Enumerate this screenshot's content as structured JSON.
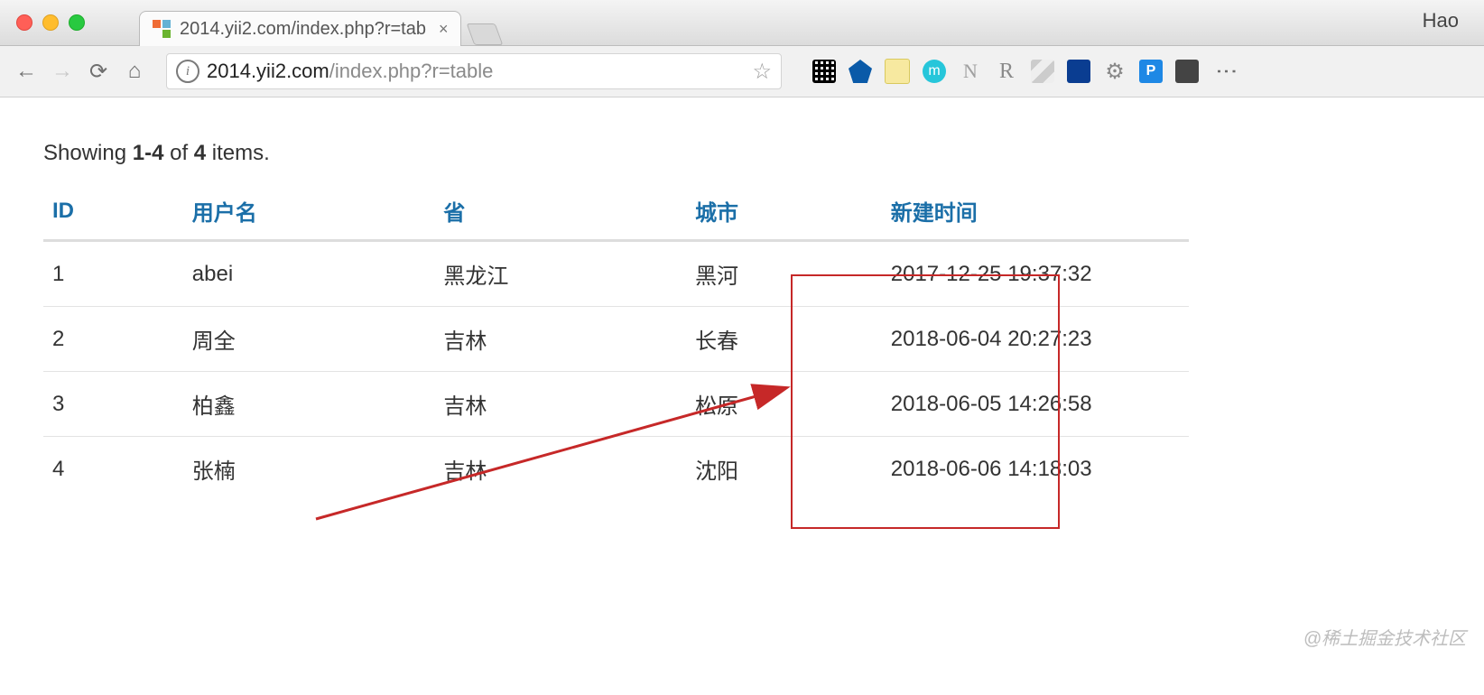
{
  "chrome": {
    "profile_name": "Hao",
    "tab_title": "2014.yii2.com/index.php?r=tab",
    "url_host": "2014.yii2.com",
    "url_path": "/index.php?r=table"
  },
  "extensions": {
    "qr": "qr-code",
    "vimium": "V",
    "note": "",
    "m": "m",
    "n": "N",
    "r": "R",
    "stripes": "",
    "zhihu": "",
    "gear": "⚙",
    "p": "P",
    "avatar": ""
  },
  "summary": {
    "prefix": "Showing ",
    "range": "1-4",
    "mid": " of ",
    "total": "4",
    "suffix": " items."
  },
  "columns": {
    "id": "ID",
    "username": "用户名",
    "province": "省",
    "city": "城市",
    "created": "新建时间"
  },
  "rows": [
    {
      "id": "1",
      "username": "abei",
      "province": "黑龙江",
      "city": "黑河",
      "created": "2017-12-25 19:37:32"
    },
    {
      "id": "2",
      "username": "周全",
      "province": "吉林",
      "city": "长春",
      "created": "2018-06-04 20:27:23"
    },
    {
      "id": "3",
      "username": "柏鑫",
      "province": "吉林",
      "city": "松原",
      "created": "2018-06-05 14:26:58"
    },
    {
      "id": "4",
      "username": "张楠",
      "province": "吉林",
      "city": "沈阳",
      "created": "2018-06-06 14:18:03"
    }
  ],
  "watermark": "@稀土掘金技术社区"
}
